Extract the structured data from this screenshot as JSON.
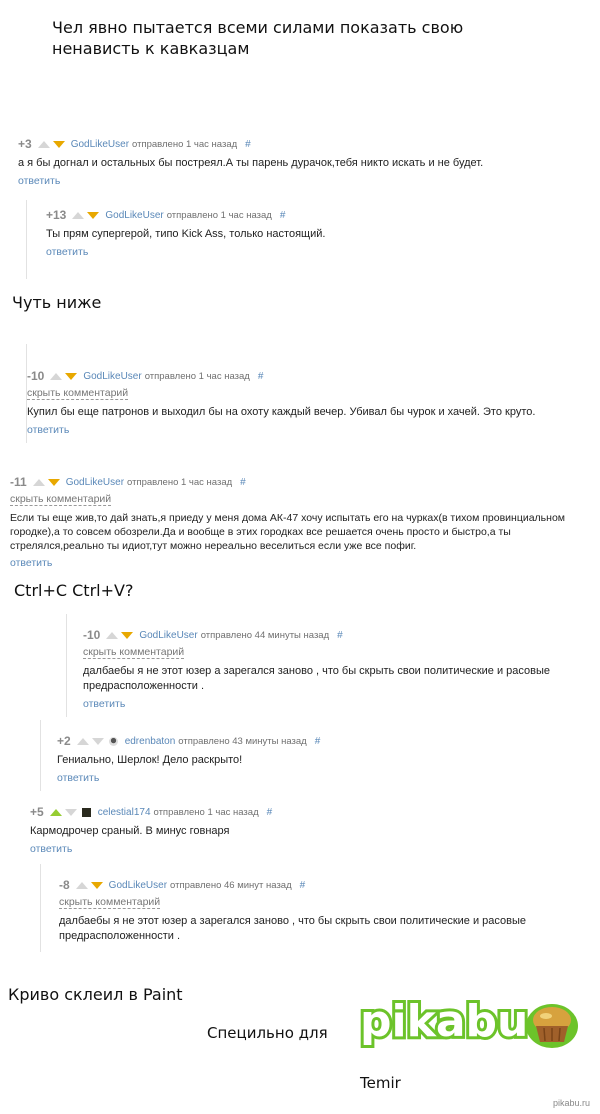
{
  "captions": {
    "intro_line1": "Чел явно пытается всеми силами показать свою",
    "intro_line2": "ненависть к кавказцам",
    "below": "Чуть ниже",
    "ctrl": "Ctrl+C  Ctrl+V?",
    "paint": "Криво склеил в Paint",
    "special": "Специльно для",
    "name": "Temir"
  },
  "comments": [
    {
      "rating": "+3",
      "user": "GodLikeUser",
      "time": "отправлено 1 час назад",
      "hash": "#",
      "hide": "",
      "text": "а я бы догнал и остальных бы постреял.А ты парень дурачок,тебя никто искать и не будет.",
      "reply": "ответить",
      "up_active": false,
      "down_active": true,
      "avatar": ""
    },
    {
      "rating": "+13",
      "user": "GodLikeUser",
      "time": "отправлено 1 час назад",
      "hash": "#",
      "hide": "",
      "text": "Ты прям супергерой, типо Kick Ass, только настоящий.",
      "reply": "ответить",
      "up_active": false,
      "down_active": true,
      "avatar": ""
    },
    {
      "rating": "-10",
      "user": "GodLikeUser",
      "time": "отправлено 1 час назад",
      "hash": "#",
      "hide": "скрыть комментарий",
      "text": "Купил бы еще патронов и выходил бы на охоту каждый вечер. Убивал бы чурок и хачей. Это круто.",
      "reply": "ответить",
      "up_active": false,
      "down_active": true,
      "avatar": ""
    },
    {
      "rating": "-11",
      "user": "GodLikeUser",
      "time": "отправлено 1 час назад",
      "hash": "#",
      "hide": "скрыть комментарий",
      "text": "Если ты еще жив,то дай знать,я приеду у меня дома АК-47 хочу испытать его на чурках(в тихом провинциальном городке),а то совсем обозрели.Да и вообще в этих городках все решается очень просто и быстро,а ты стрелялся,реально ты идиот,тут можно нереально веселиться если уже все пофиг.",
      "reply": "ответить",
      "up_active": false,
      "down_active": true,
      "avatar": ""
    },
    {
      "rating": "-10",
      "user": "GodLikeUser",
      "time": "отправлено 44 минуты назад",
      "hash": "#",
      "hide": "скрыть комментарий",
      "text": "далбаебы я не этот юзер а зарегался заново , что бы скрыть свои политические и расовые предрасположенности .",
      "reply": "ответить",
      "up_active": false,
      "down_active": true,
      "avatar": ""
    },
    {
      "rating": "+2",
      "user": "edrenbaton",
      "time": "отправлено 43 минуты назад",
      "hash": "#",
      "hide": "",
      "text": "Гениально, Шерлок! Дело раскрыто!",
      "reply": "ответить",
      "up_active": false,
      "down_active": false,
      "avatar": "mask"
    },
    {
      "rating": "+5",
      "user": "celestial174",
      "time": "отправлено 1 час назад",
      "hash": "#",
      "hide": "",
      "text": "Кармодрочер сраный. В минус говнаря",
      "reply": "ответить",
      "up_active": true,
      "down_active": false,
      "avatar": "dark"
    },
    {
      "rating": "-8",
      "user": "GodLikeUser",
      "time": "отправлено 46 минут назад",
      "hash": "#",
      "hide": "скрыть комментарий",
      "text": "далбаебы я не этот юзер а зарегался заново , что бы скрыть свои политические и расовые предрасположенности .",
      "reply": "",
      "up_active": false,
      "down_active": true,
      "avatar": ""
    }
  ],
  "logo": {
    "text": "pikabu",
    "color": "#6cc32a"
  },
  "watermark": "pikabu.ru"
}
